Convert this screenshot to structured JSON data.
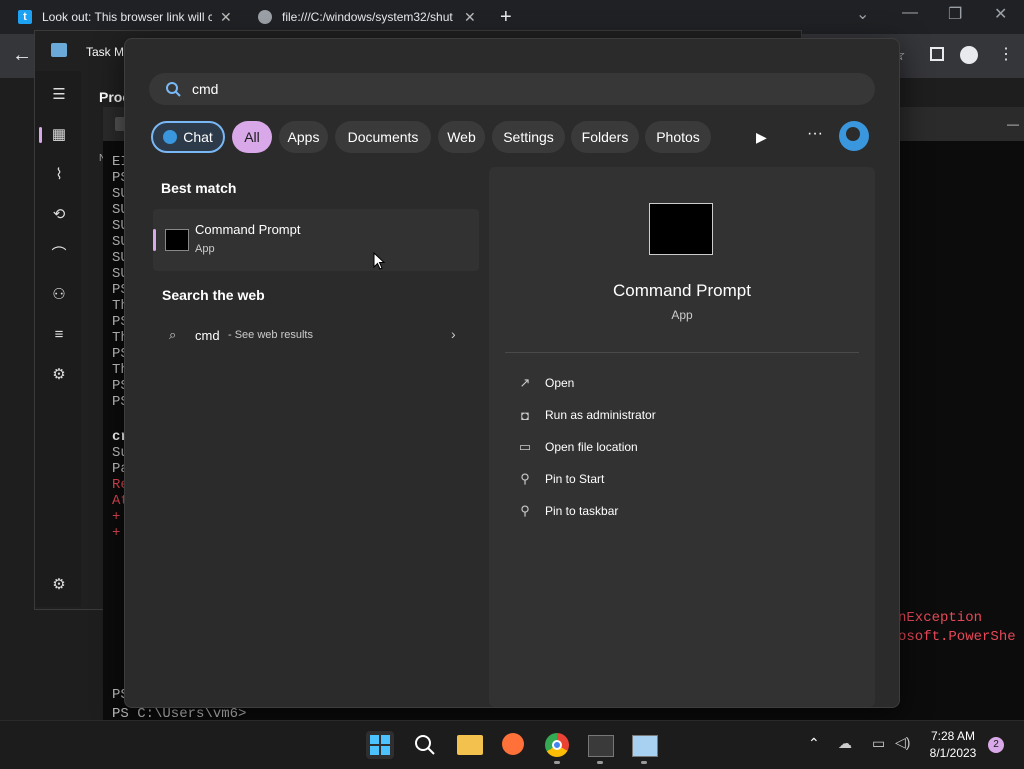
{
  "browser": {
    "tabs": [
      {
        "label": "Look out: This browser link will c"
      },
      {
        "label": "file:///C:/windows/system32/shut"
      }
    ]
  },
  "taskmgr": {
    "title": "Task Ma",
    "section": "Proc",
    "col": "N"
  },
  "terminal": {
    "lines": [
      "EI",
      "PS",
      "SU",
      "SU",
      "SU",
      "SU",
      "SU",
      "SU",
      "PS",
      "Th",
      "PS",
      "Th",
      "PS",
      "Th",
      "PS",
      "PS",
      "",
      "cr",
      "Su",
      "Pa",
      "Re",
      "At",
      "+",
      "+"
    ],
    "red_right_1": "nException",
    "red_right_2": "osoft.PowerShe",
    "prompt_partial": "PS",
    "prompt": "PS C:\\Users\\vm6>"
  },
  "search": {
    "query": "cmd"
  },
  "filters": [
    "Chat",
    "All",
    "Apps",
    "Documents",
    "Web",
    "Settings",
    "Folders",
    "Photos"
  ],
  "best_match": {
    "heading": "Best match",
    "name": "Command Prompt",
    "type": "App"
  },
  "web": {
    "heading": "Search the web",
    "query": "cmd",
    "suffix": "- See web results"
  },
  "detail": {
    "name": "Command Prompt",
    "type": "App",
    "actions": [
      "Open",
      "Run as administrator",
      "Open file location",
      "Pin to Start",
      "Pin to taskbar"
    ]
  },
  "tray": {
    "time": "7:28 AM",
    "date": "8/1/2023",
    "badge": "2"
  },
  "colors": {
    "accent": "#d8a8e8",
    "chat_border": "#7ab8f5",
    "bing_blue": "#3a96dd"
  }
}
